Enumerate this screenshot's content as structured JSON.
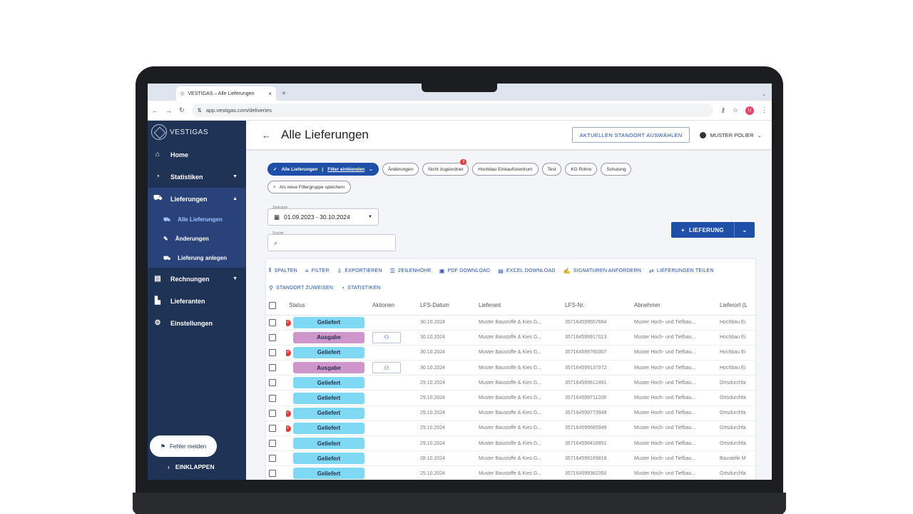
{
  "browser": {
    "tab_title": "VESTIGAS – Alle Lieferungen",
    "url": "app.vestigas.com/deliveries",
    "profile_initial": "U"
  },
  "sidebar": {
    "logo": "VESTIGAS",
    "items": [
      {
        "label": "Home",
        "icon": "home-icon"
      },
      {
        "label": "Statistiken",
        "icon": "pie-chart-icon"
      },
      {
        "label": "Lieferungen",
        "icon": "truck-icon"
      },
      {
        "label": "Rechnungen",
        "icon": "invoice-icon"
      },
      {
        "label": "Lieferanten",
        "icon": "factory-icon"
      },
      {
        "label": "Einstellungen",
        "icon": "gear-icon"
      }
    ],
    "sub_items": [
      {
        "label": "Alle Lieferungen",
        "icon": "truck-icon"
      },
      {
        "label": "Änderungen",
        "icon": "pencil-icon"
      },
      {
        "label": "Lieferung anlegen",
        "icon": "truck-plus-icon"
      }
    ],
    "fehler_label": "Fehler melden",
    "collapse_label": "EINKLAPPEN"
  },
  "header": {
    "title": "Alle Lieferungen",
    "standort_button": "AKTUELLEN STANDORT AUSWÄHLEN",
    "user_name": "MUSTER POLIER"
  },
  "filters": {
    "main_label": "Alle Lieferungen",
    "main_link": "Filter einblenden",
    "chips": [
      "Änderungen",
      "Nicht zugeordnet",
      "Hochbau Einkaufszentrum",
      "Test",
      "KG Rohre",
      "Schulung"
    ],
    "badge_count": "3",
    "save_label": "Als neue Filtergruppe speichern"
  },
  "zeitraum": {
    "label": "Zeitraum",
    "value": "01.09.2023 - 30.10.2024"
  },
  "suche": {
    "label": "Suche"
  },
  "lieferung_button": "LIEFERUNG",
  "toolbar": [
    {
      "label": "SPALTEN",
      "icon": "columns-icon"
    },
    {
      "label": "FILTER",
      "icon": "filter-icon"
    },
    {
      "label": "EXPORTIEREN",
      "icon": "export-icon"
    },
    {
      "label": "ZEILENHÖHE",
      "icon": "row-height-icon"
    },
    {
      "label": "PDF DOWNLOAD",
      "icon": "pdf-icon"
    },
    {
      "label": "EXCEL DOWNLOAD",
      "icon": "excel-icon"
    },
    {
      "label": "SIGNATUREN ANFORDERN",
      "icon": "signature-icon"
    },
    {
      "label": "LIEFERUNGEN TEILEN",
      "icon": "share-icon"
    },
    {
      "label": "STANDORT ZUWEISEN",
      "icon": "location-icon"
    },
    {
      "label": "STATISTIKEN",
      "icon": "pie-chart-icon"
    }
  ],
  "table": {
    "columns": [
      "Status",
      "Aktionen",
      "LFS-Datum",
      "Lieferant",
      "LFS-Nr.",
      "Abnehmer",
      "Lieferort (L"
    ],
    "rows": [
      {
        "status": "Geliefert",
        "error": true,
        "action": false,
        "date": "30.10.2024",
        "lieferant": "Muster Baustoffe & Kies G...",
        "nr": "357164599557664",
        "abnehmer": "Muster Hoch- und Tiefbau...",
        "ort": "Hochbau Ei"
      },
      {
        "status": "Ausgabe",
        "error": false,
        "action": true,
        "date": "30.10.2024",
        "lieferant": "Muster Baustoffe & Kies G...",
        "nr": "357164599917013",
        "abnehmer": "Muster Hoch- und Tiefbau...",
        "ort": "Hochbau Ei"
      },
      {
        "status": "Geliefert",
        "error": true,
        "action": false,
        "date": "30.10.2024",
        "lieferant": "Muster Baustoffe & Kies G...",
        "nr": "357164599760307",
        "abnehmer": "Muster Hoch- und Tiefbau...",
        "ort": "Hochbau Ei"
      },
      {
        "status": "Ausgabe",
        "error": false,
        "action": true,
        "date": "30.10.2024",
        "lieferant": "Muster Baustoffe & Kies G...",
        "nr": "357164599137972",
        "abnehmer": "Muster Hoch- und Tiefbau...",
        "ort": "Hochbau Ei"
      },
      {
        "status": "Geliefert",
        "error": false,
        "action": false,
        "date": "29.10.2024",
        "lieferant": "Muster Baustoffe & Kies G...",
        "nr": "357164599612491",
        "abnehmer": "Muster Hoch- und Tiefbau...",
        "ort": "Ortsdurchfa"
      },
      {
        "status": "Geliefert",
        "error": false,
        "action": false,
        "date": "29.10.2024",
        "lieferant": "Muster Baustoffe & Kies G...",
        "nr": "357164599711209",
        "abnehmer": "Muster Hoch- und Tiefbau...",
        "ort": "Ortsdurchfa"
      },
      {
        "status": "Geliefert",
        "error": true,
        "action": false,
        "date": "29.10.2024",
        "lieferant": "Muster Baustoffe & Kies G...",
        "nr": "357164599773949",
        "abnehmer": "Muster Hoch- und Tiefbau...",
        "ort": "Ortsdurchfa"
      },
      {
        "status": "Geliefert",
        "error": true,
        "action": false,
        "date": "29.10.2024",
        "lieferant": "Muster Baustoffe & Kies G...",
        "nr": "357164599685949",
        "abnehmer": "Muster Hoch- und Tiefbau...",
        "ort": "Ortsdurchfa"
      },
      {
        "status": "Geliefert",
        "error": false,
        "action": false,
        "date": "29.10.2024",
        "lieferant": "Muster Baustoffe & Kies G...",
        "nr": "357164599418951",
        "abnehmer": "Muster Hoch- und Tiefbau...",
        "ort": "Ortsdurchfa"
      },
      {
        "status": "Geliefert",
        "error": false,
        "action": false,
        "date": "28.10.2024",
        "lieferant": "Muster Baustoffe & Kies G...",
        "nr": "357164599169818",
        "abnehmer": "Muster Hoch- und Tiefbau...",
        "ort": "Baustelle M"
      },
      {
        "status": "Geliefert",
        "error": false,
        "action": false,
        "date": "25.10.2024",
        "lieferant": "Muster Baustoffe & Kies G...",
        "nr": "357164599382350",
        "abnehmer": "Muster Hoch- und Tiefbau...",
        "ort": "Ortsdurchfa"
      }
    ]
  },
  "colors": {
    "sidebar": "#1f3357",
    "accent": "#1f4fa8",
    "geliefert": "#7fd8f4",
    "ausgabe": "#cf96cc",
    "error": "#e53935"
  }
}
